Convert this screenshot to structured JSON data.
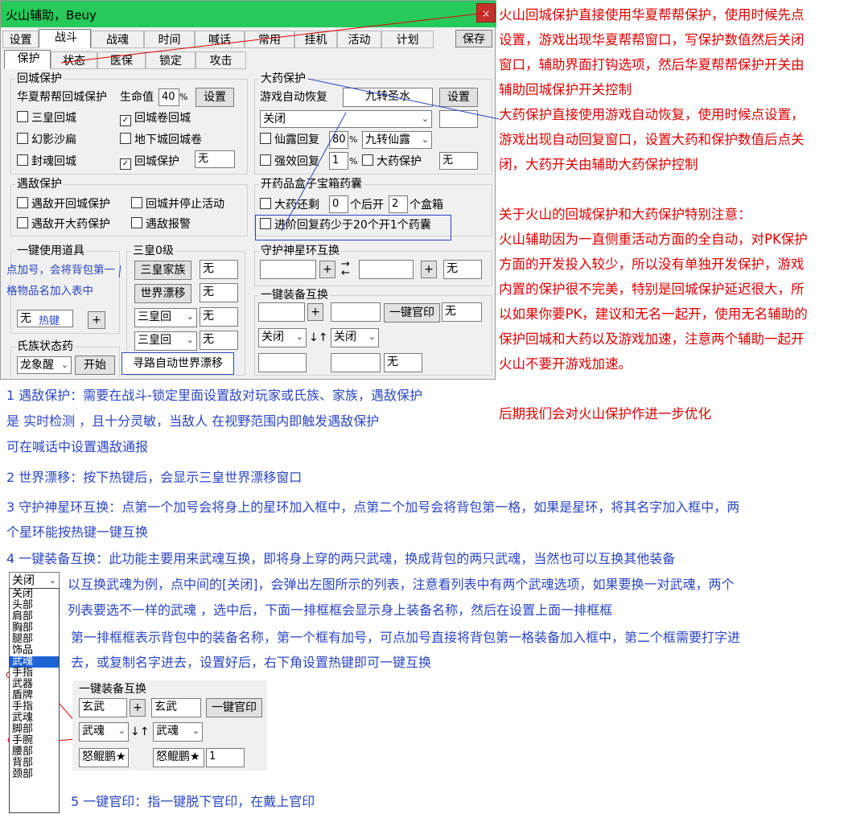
{
  "window": {
    "title": "火山辅助，Beuy",
    "close": "×"
  },
  "tabs": [
    "设置",
    "战斗",
    "战魂",
    "时间",
    "喊话",
    "常用",
    "挂机",
    "活动",
    "计划"
  ],
  "save_button": "保存",
  "subtabs": [
    "保护",
    "状态",
    "医保",
    "锁定",
    "攻击"
  ],
  "city_guard": {
    "title": "回城保护",
    "huaxia_label": "华夏帮帮回城保护",
    "hp_label": "生命值",
    "hp_value": "40",
    "pct": "%",
    "set": "设置",
    "sanhuang": "三皇回城",
    "scroll": "回城卷回城",
    "huanying": "幻影沙扁",
    "dungeon": "地下城回城卷",
    "fenghun": "封魂回城",
    "protect": "回城保护",
    "protect_value": "无"
  },
  "big_potion": {
    "title": "大药保护",
    "auto_restore": "游戏自动恢复",
    "potion_name": "九转圣水",
    "set": "设置",
    "mode": "关闭",
    "xianlu": "仙露回复",
    "xianlu_value": "80",
    "pct": "%",
    "xianlu_item": "九转仙露",
    "qiangxiao": "强效回复",
    "qiangxiao_value": "1",
    "pct2": "%",
    "bigprotect": "大药保护",
    "bigprotect_value": "无"
  },
  "enemy": {
    "title": "遇敌保护",
    "a": "遇敌开回城保护",
    "b": "回城并停止活动",
    "c": "遇敌开大药保护",
    "d": "遇敌报警"
  },
  "open_box": {
    "title": "开药品盒子宝箱药囊",
    "a": "大药还剩",
    "a_val": "0",
    "a_mid": "个后开",
    "a_val2": "2",
    "a_end": "个盒箱",
    "b": "进阶回复药少于20个开1个药囊"
  },
  "one_key_item": {
    "title": "一键使用道具",
    "note1": "点加号，会将背包第一",
    "note2": "格物品名加入表中",
    "value": "无",
    "hotkey": "热键",
    "plus": "+"
  },
  "sanhuang0": {
    "title": "三皇0级",
    "b1": "三皇家族",
    "b2": "世界漂移",
    "b3": "三皇回",
    "b4": "三皇回",
    "v1": "无",
    "v2": "无",
    "v3": "无",
    "v4": "无"
  },
  "clan_potion": {
    "title": "氏族状态药",
    "select": "龙象醒",
    "start": "开始"
  },
  "xinghuan": {
    "title": "守护神星环互换",
    "plus": "+",
    "plus2": "+",
    "value": "无"
  },
  "equip_swap": {
    "title": "一键装备互换",
    "plus": "+",
    "guanyin": "一键官印",
    "value": "无",
    "sel1": "关闭",
    "sel2": "关闭",
    "value2": "无"
  },
  "auto_world": "寻路自动世界漂移",
  "red_notes": [
    "火山回城保护直接使用华夏帮帮保护，使用时候先点",
    "设置，游戏出现华夏帮帮窗口，写保护数值然后关闭",
    "窗口，辅助界面打钩选项，然后华夏帮帮保护开关由",
    "辅助回城保护开关控制",
    "大药保护直接使用游戏自动恢复，使用时候点设置，",
    "游戏出现自动回复窗口，设置大药和保护数值后点关",
    "闭，大药开关由辅助大药保护控制",
    "",
    "关于火山的回城保护和大药保护特别注意：",
    "火山辅助因为一直侧重活动方面的全自动，对PK保护",
    "方面的开发投入较少，所以没有单独开发保护，游戏",
    "内置的保护很不完美，特别是回城保护延迟很大，所",
    "以如果你要PK，建议和无名一起开，使用无名辅助的",
    "保护回城和大药以及游戏加速，注意两个辅助一起开",
    "火山不要开游戏加速。",
    "",
    "后期我们会对火山保护作进一步优化"
  ],
  "blue_notes": {
    "n1a": "1 遇敌保护：需要在战斗-锁定里面设置敌对玩家或氏族、家族，遇敌保护",
    "n1b": "是  实时检测 ，且十分灵敏，当敌人 在视野范围内即触发遇敌保护",
    "n1c": " 可在喊话中设置遇敌通报",
    "n2": "2 世界漂移：按下热键后，会显示三皇世界漂移窗口",
    "n3a": "3 守护神星环互换：点第一个加号会将身上的星环加入框中，点第二个加号会将背包第一格，如果是星环，将其名字加入框中，两",
    "n3b": "个星环能按热键一键互换",
    "n4": " 4 一键装备互换：此功能主要用来武魂互换，即将身上穿的两只武魂，换成背包的两只武魂，当然也可以互换其他装备",
    "n4a": "以互换武魂为例，点中间的[关闭]，会弹出左图所示的列表，注意看列表中有两个武魂选项，如果要换一对武魂，两个",
    "n4b": "列表要选不一样的武魂 ，选中后，下面一排框框会显示身上装备名称，然后在设置上面一排框框",
    "n4c": "第一排框框表示背包中的装备名称，第一个框有加号，可点加号直接将背包第一格装备加入框中，第二个框需要打字进",
    "n4d": "去，或复制名字进去，设置好后，右下角设置热键即可一键互换",
    "n5": "5 一键官印：指一键脱下官印，在戴上官印"
  },
  "dropdown": {
    "selected": "关闭",
    "items": [
      "关闭",
      "头部",
      "肩部",
      "胸部",
      "腿部",
      "饰品",
      "武魂",
      "手指",
      "武器",
      "盾牌",
      "手指",
      "武魂",
      "脚部",
      "手腕",
      "腰部",
      "背部",
      "颈部"
    ],
    "highlight": 6
  },
  "example": {
    "title": "一键装备互换",
    "a": "玄武",
    "plus": "+",
    "b": "玄武",
    "guanyin": "一键官印",
    "s1": "武魂",
    "s2": "武魂",
    "c": "怒鲲鹏★",
    "d": "怒鲲鹏★",
    "e": "1"
  },
  "colors": {
    "title_bar": "#26c95a",
    "note_red": "#e00000",
    "note_blue": "#2b46c4"
  }
}
